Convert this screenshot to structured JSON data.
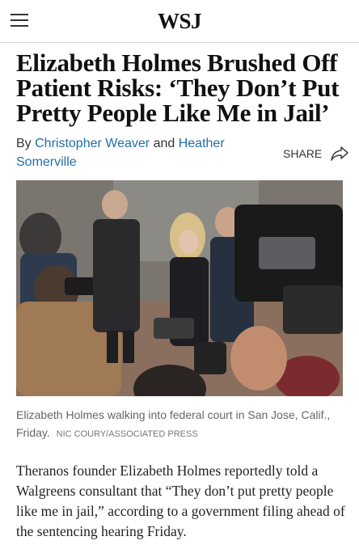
{
  "header": {
    "logo": "WSJ",
    "menu_icon": "hamburger-menu-icon"
  },
  "article": {
    "headline": "Elizabeth Holmes Brushed Off Patient Risks: ‘They Don’t Put Pretty People Like Me in Jail’",
    "byline_prefix": "By",
    "author_1": "Christopher Weaver",
    "byline_joiner": "and",
    "author_2": "Heather Somerville",
    "share_label": "SHARE",
    "share_icon": "share-arrow-icon",
    "caption": "Elizabeth Holmes walking into federal court in San Jose, Calif., Friday.",
    "credit": "NIC COURY/ASSOCIATED PRESS",
    "body": "Theranos founder Elizabeth Holmes reportedly told a Walgreens consultant that “They don’t put pretty people like me in jail,” according to a government filing ahead of the sentencing hearing Friday."
  },
  "colors": {
    "link": "#1f6fa8",
    "headline": "#111111",
    "caption": "#666666"
  }
}
